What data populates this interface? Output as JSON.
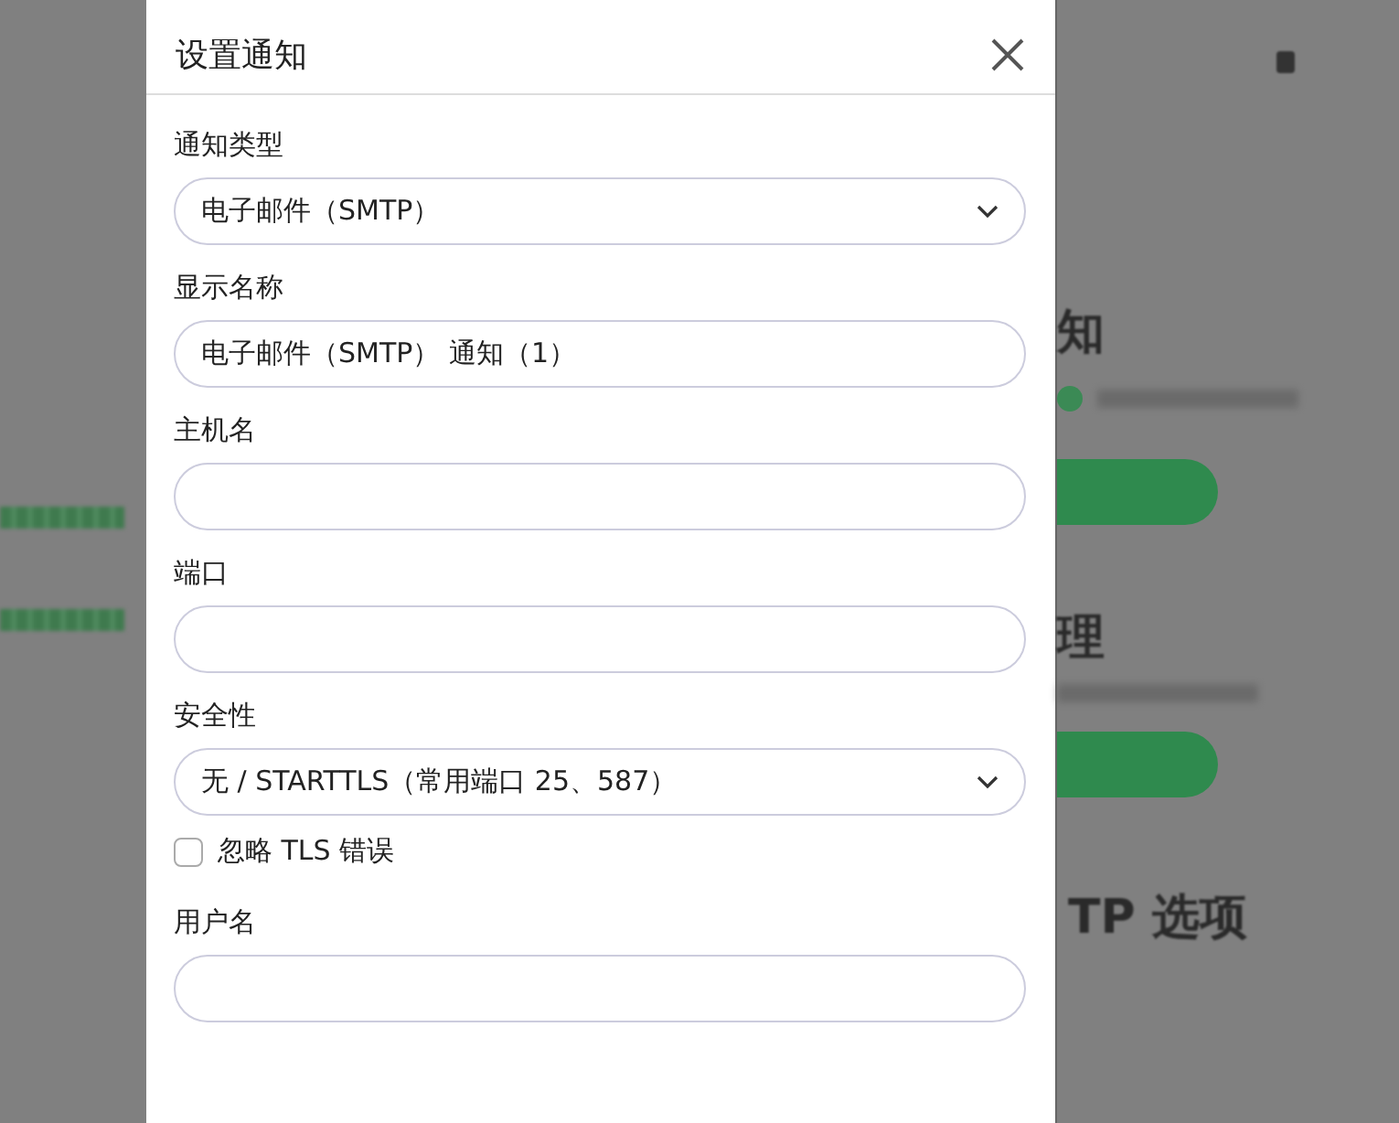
{
  "background": {
    "headings": [
      "知",
      "理",
      "TP 选项"
    ]
  },
  "dialog": {
    "title": "设置通知",
    "fields": [
      {
        "kind": "select",
        "label": "通知类型",
        "value": "电子邮件（SMTP）"
      },
      {
        "kind": "input",
        "label": "显示名称",
        "value": "电子邮件（SMTP） 通知（1）"
      },
      {
        "kind": "input",
        "label": "主机名"
      },
      {
        "kind": "input",
        "label": "端口"
      },
      {
        "kind": "select",
        "label": "安全性",
        "value": "无 / STARTTLS（常用端口 25、587）"
      },
      {
        "kind": "checkbox",
        "label": "忽略 TLS 错误",
        "checked": false
      },
      {
        "kind": "input",
        "label": "用户名"
      }
    ]
  }
}
